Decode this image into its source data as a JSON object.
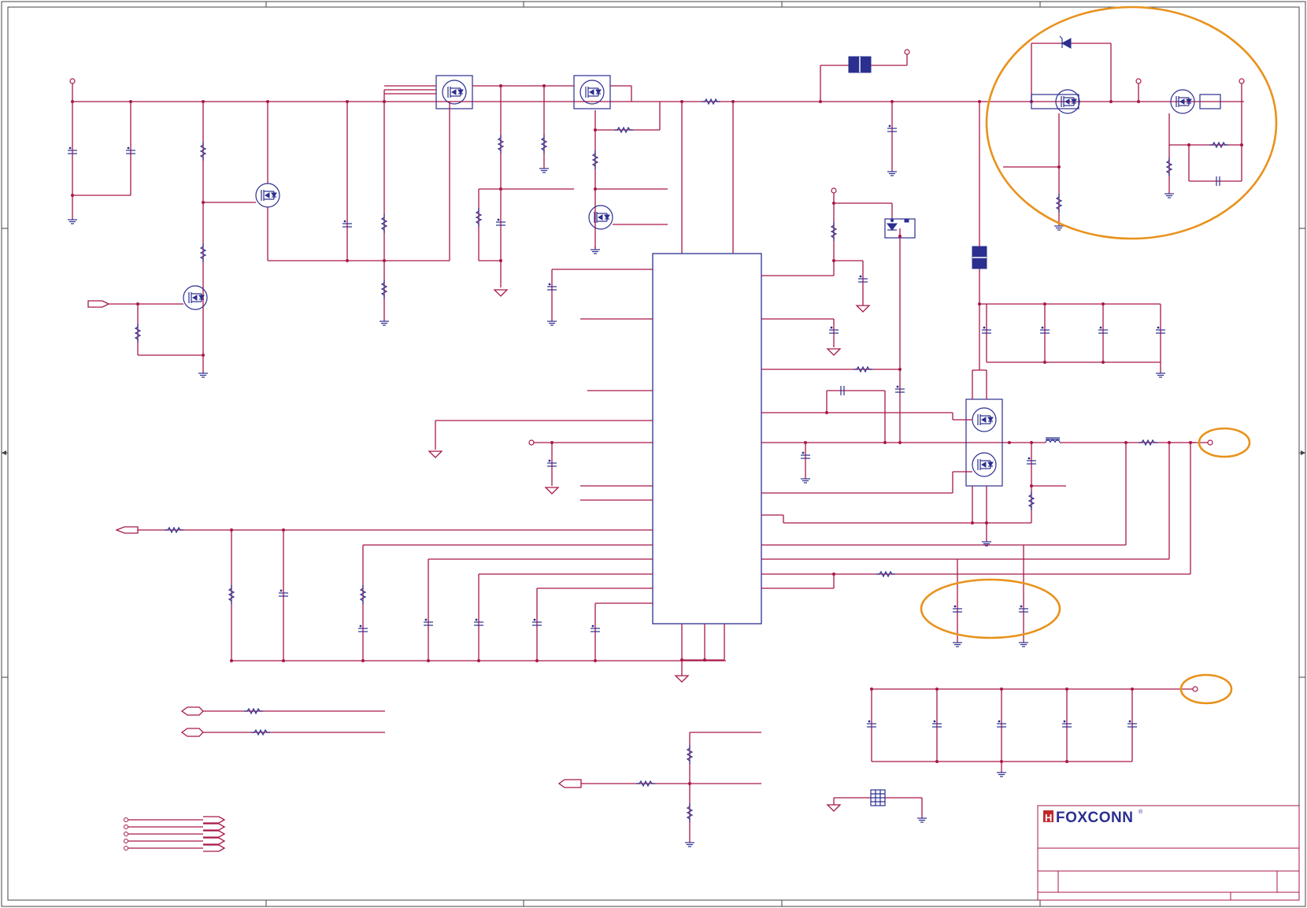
{
  "title_block": {
    "logo_text": "FOXCONN",
    "logo_mark": "H",
    "registered_mark": "®"
  },
  "colors": {
    "wire": "#a8174a",
    "part": "#2b2f8f",
    "highlight": "#e8921c"
  },
  "icons": [
    "mosfet-icon",
    "resistor-icon",
    "capacitor-icon",
    "ground-icon",
    "inductor-icon",
    "diode-icon",
    "connector-icon"
  ]
}
